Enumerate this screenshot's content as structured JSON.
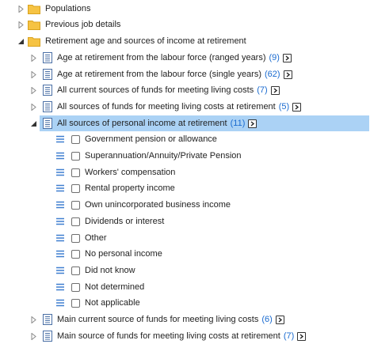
{
  "tree": {
    "top_items": [
      {
        "label": "Populations"
      },
      {
        "label": "Previous job details"
      },
      {
        "label": "Retirement age and sources of income at retirement"
      }
    ],
    "sub_items": [
      {
        "label": "Age at retirement from the labour force (ranged years)",
        "count": "(9)"
      },
      {
        "label": "Age at retirement from the labour force (single years)",
        "count": "(62)"
      },
      {
        "label": "All current sources of funds for meeting living costs",
        "count": "(7)"
      },
      {
        "label": "All sources of funds for meeting living costs at retirement",
        "count": "(5)"
      },
      {
        "label": "All sources of personal income at retirement",
        "count": "(11)"
      }
    ],
    "categories": [
      {
        "label": "Government pension or allowance"
      },
      {
        "label": "Superannuation/Annuity/Private Pension"
      },
      {
        "label": "Workers' compensation"
      },
      {
        "label": "Rental property income"
      },
      {
        "label": "Own unincorporated business income"
      },
      {
        "label": "Dividends or interest"
      },
      {
        "label": "Other"
      },
      {
        "label": "No personal income"
      },
      {
        "label": "Did not know"
      },
      {
        "label": "Not determined"
      },
      {
        "label": "Not applicable"
      }
    ],
    "bottom_items": [
      {
        "label": "Main current source of funds for meeting living costs",
        "count": "(6)"
      },
      {
        "label": "Main source of funds for meeting living costs at retirement",
        "count": "(7)"
      }
    ]
  },
  "colors": {
    "selection": "#abd2f5",
    "count": "#1a6bd0",
    "folder": "#f6c343",
    "doc": "#4a6fa5",
    "lines_icon": "#3f7fd0"
  },
  "icons": {
    "folder": "folder-icon",
    "document": "document-icon",
    "category": "list-lines-icon",
    "expand": "caret-right-icon",
    "collapse": "caret-down-icon",
    "navigate": "chevron-right-box-icon"
  }
}
